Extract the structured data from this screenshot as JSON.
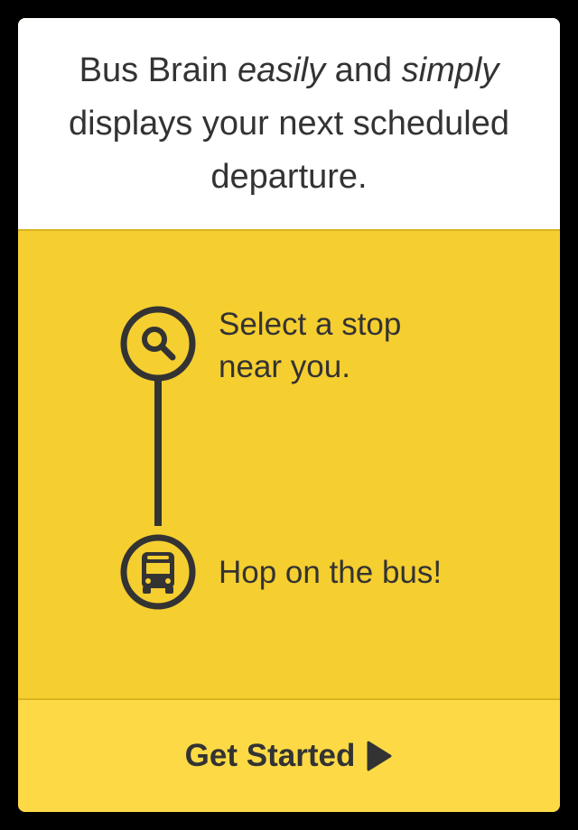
{
  "intro": {
    "part1": "Bus Brain ",
    "emphasis1": "easily",
    "part2": " and ",
    "emphasis2": "simply",
    "part3": " displays your next scheduled departure."
  },
  "steps": [
    {
      "icon": "search-icon",
      "line1": "Select a stop",
      "line2": "near you."
    },
    {
      "icon": "bus-icon",
      "line1": "Hop on the bus!"
    }
  ],
  "cta": {
    "label": "Get Started",
    "icon": "play-arrow-icon"
  },
  "colors": {
    "accent_yellow": "#f5ce30",
    "footer_yellow": "#fdda45",
    "text_dark": "#333333",
    "background": "#000000"
  }
}
